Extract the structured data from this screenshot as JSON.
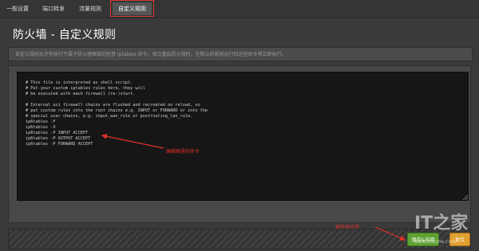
{
  "tabs": [
    {
      "label": "一般设置",
      "active": false
    },
    {
      "label": "端口转发",
      "active": false
    },
    {
      "label": "流量规则",
      "active": false
    },
    {
      "label": "自定义规则",
      "active": true
    }
  ],
  "page": {
    "title": "防火墙 - 自定义规则",
    "description": "自定义规则允许你执行不属于防火墙框架的任意 iptables 命令。每次重启防火墙时，在默认的规则运行后这些命令将立即执行。"
  },
  "editor": {
    "lines": [
      "# This file is interpreted as shell script.",
      "# Put your custom iptables rules here, they will",
      "# be executed with each firewall (re-)start.",
      "",
      "# Internal uci firewall chains are flushed and recreated on reload, so",
      "# put custom rules into the root chains e.g. INPUT or FORWARD or into the",
      "# special user chains, e.g. input_wan_rule or postrouting_lan_rule.",
      "ip6tables -F",
      "ip6tables -X",
      "ip6tables -P INPUT ACCEPT",
      "ip6tables -P OUTPUT ACCEPT",
      "ip6tables -P FORWARD ACCEPT"
    ]
  },
  "annotations": {
    "editor_note": "编辑框里的命令",
    "button_note": "保存并应用"
  },
  "buttons": {
    "apply": "保存&应用",
    "reset": "复位"
  },
  "watermark": {
    "logo": "IT之家",
    "url": "www.ithome.com"
  },
  "colors": {
    "annotation_red": "#e0302a",
    "apply_green": "#5fa234",
    "reset_orange": "#e0a030"
  }
}
